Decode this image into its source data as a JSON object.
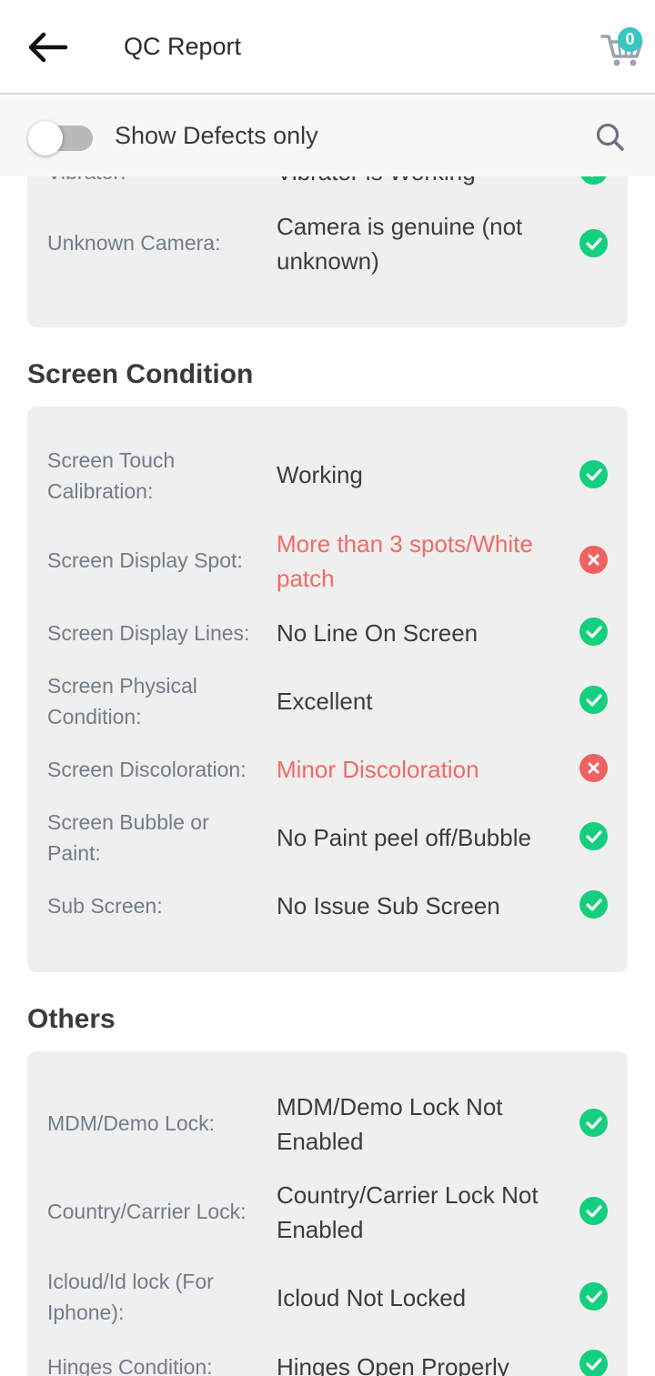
{
  "header": {
    "title": "QC Report",
    "cart_count": "0"
  },
  "filter": {
    "label": "Show Defects only",
    "enabled": false
  },
  "partial_top": {
    "label": "Vibrator:",
    "value": "Vibrator is Working",
    "status": "ok"
  },
  "sections": [
    {
      "rows": [
        {
          "label": "Unknown Camera:",
          "value": "Camera is genuine (not unknown)",
          "status": "ok"
        }
      ]
    },
    {
      "title": "Screen Condition",
      "rows": [
        {
          "label": "Screen Touch Calibration:",
          "value": "Working",
          "status": "ok"
        },
        {
          "label": "Screen Display Spot:",
          "value": "More than 3 spots/White patch",
          "status": "defect"
        },
        {
          "label": "Screen Display Lines:",
          "value": "No Line On Screen",
          "status": "ok"
        },
        {
          "label": "Screen Physical Condition:",
          "value": "Excellent",
          "status": "ok"
        },
        {
          "label": "Screen Discoloration:",
          "value": "Minor Discoloration",
          "status": "defect"
        },
        {
          "label": "Screen Bubble or Paint:",
          "value": "No Paint peel off/Bubble",
          "status": "ok"
        },
        {
          "label": "Sub Screen:",
          "value": "No Issue Sub Screen",
          "status": "ok"
        }
      ]
    },
    {
      "title": "Others",
      "rows": [
        {
          "label": "MDM/Demo Lock:",
          "value": "MDM/Demo Lock Not Enabled",
          "status": "ok"
        },
        {
          "label": "Country/Carrier Lock:",
          "value": "Country/Carrier Lock Not Enabled",
          "status": "ok"
        },
        {
          "label": "Icloud/Id lock (For Iphone):",
          "value": "Icloud Not Locked",
          "status": "ok"
        },
        {
          "label": "Hinges Condition:",
          "value": "Hinges Open Properly",
          "status": "ok"
        }
      ]
    }
  ],
  "colors": {
    "ok": "#14cf7d",
    "defect": "#f06262",
    "accent": "#37c7c2"
  }
}
